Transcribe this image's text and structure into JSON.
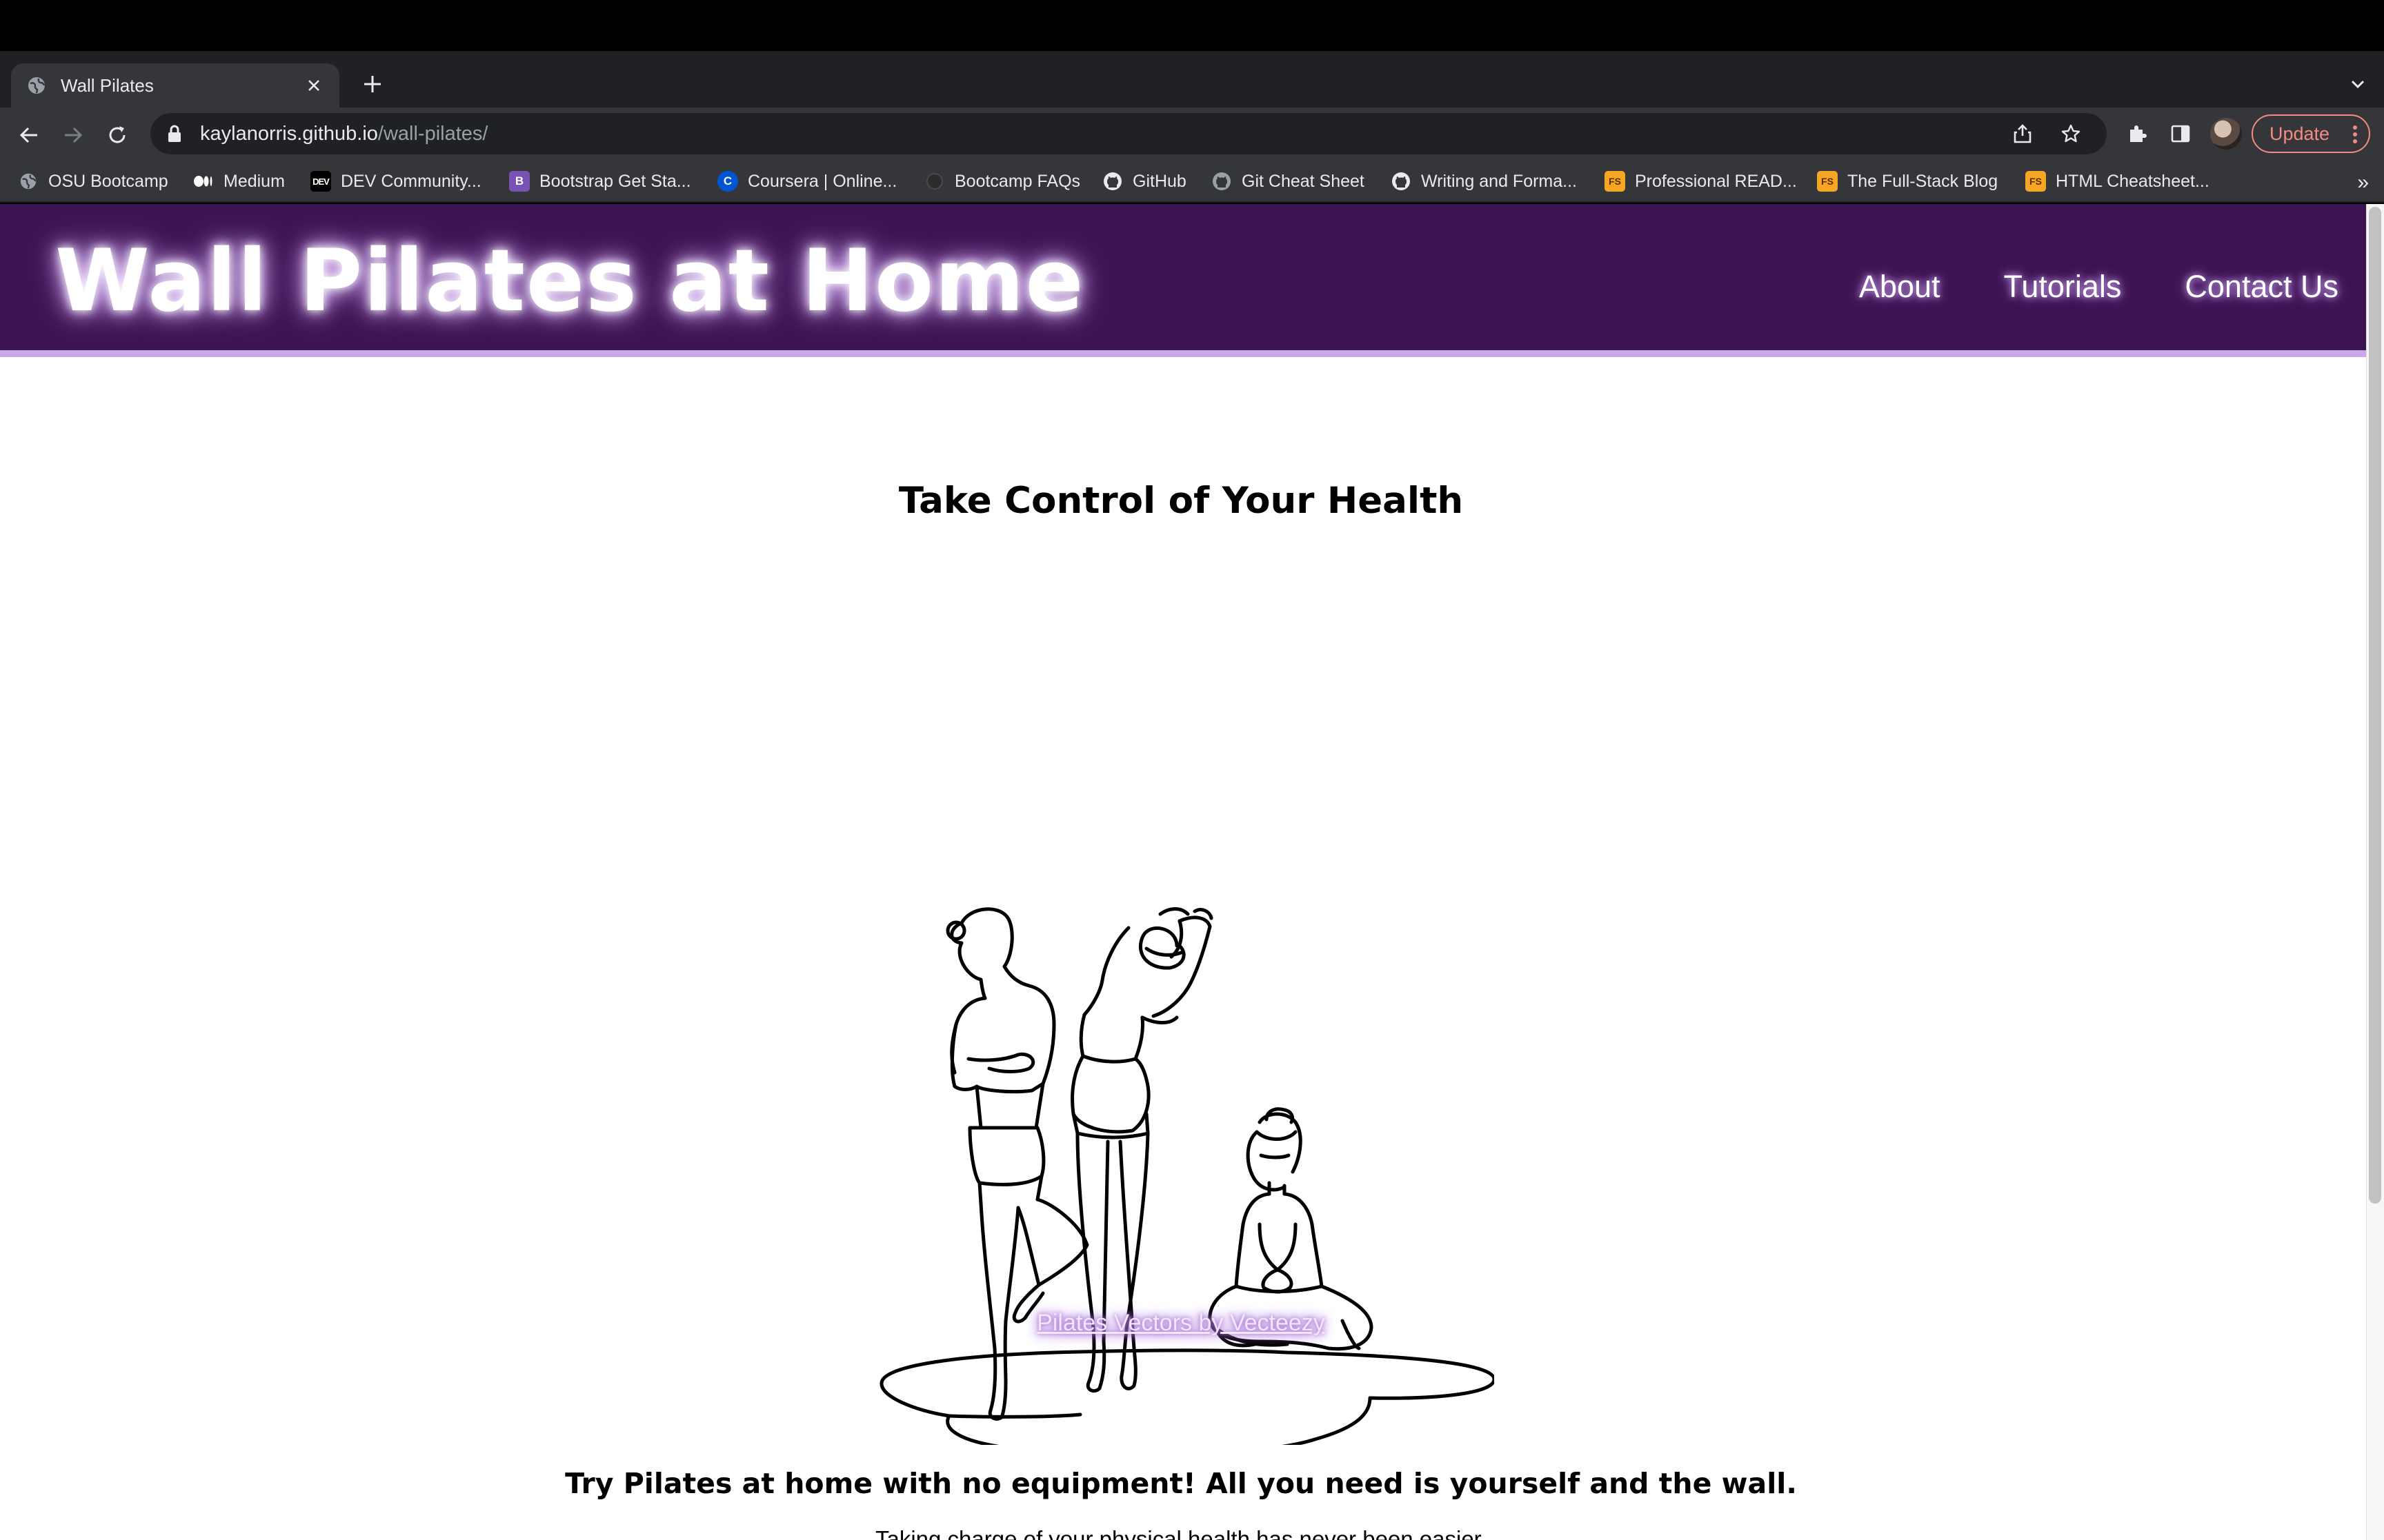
{
  "browser": {
    "tab_title": "Wall Pilates",
    "url_host": "kaylanorris.github.io",
    "url_path": "/wall-pilates/",
    "update_label": "Update",
    "bookmarks": [
      {
        "label": "OSU Bootcamp",
        "icon": "globe-icon"
      },
      {
        "label": "Medium",
        "icon": "medium-icon"
      },
      {
        "label": "DEV Community...",
        "icon": "dev-icon"
      },
      {
        "label": "Bootstrap Get Sta...",
        "icon": "bootstrap-icon"
      },
      {
        "label": "Coursera | Online...",
        "icon": "coursera-icon"
      },
      {
        "label": "Bootcamp FAQs",
        "icon": "circle-icon"
      },
      {
        "label": "GitHub",
        "icon": "github-icon"
      },
      {
        "label": "Git Cheat Sheet",
        "icon": "github-icon"
      },
      {
        "label": "Writing and Forma...",
        "icon": "github-icon"
      },
      {
        "label": "Professional READ...",
        "icon": "fs-icon"
      },
      {
        "label": "The Full-Stack Blog",
        "icon": "fs-icon"
      },
      {
        "label": "HTML Cheatsheet...",
        "icon": "fs-icon"
      }
    ],
    "bookmarks_more": "»"
  },
  "site": {
    "title": "Wall Pilates at Home",
    "nav": [
      "About",
      "Tutorials",
      "Contact Us"
    ]
  },
  "main": {
    "headline": "Take Control of Your Health",
    "image_credit": "Pilates Vectors by Vecteezy",
    "tagline": "Try Pilates at home with no equipment! All you need is yourself and the wall.",
    "subtext": "Taking charge of your physical health has never been easier."
  },
  "colors": {
    "header_bg": "#3d1452",
    "header_border": "#c8a9e9",
    "glow": "#c28ff0"
  }
}
